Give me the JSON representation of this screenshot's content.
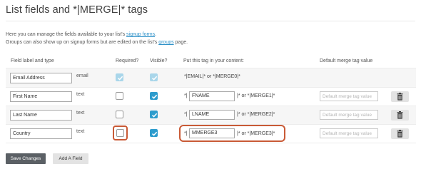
{
  "page": {
    "title": "List fields and *|MERGE|* tags"
  },
  "intro": {
    "line1_prefix": "Here you can manage the fields available to your list's ",
    "line1_link": "signup forms",
    "line1_suffix": ".",
    "line2_prefix": "Groups can also show up on signup forms but are edited on the list's ",
    "line2_link": "groups",
    "line2_suffix": " page."
  },
  "table": {
    "headers": {
      "label": "Field label and type",
      "required": "Required?",
      "visible": "Visible?",
      "tag": "Put this tag in your content:",
      "default": "Default merge tag value"
    },
    "rows": [
      {
        "label": "Email Address",
        "type": "email",
        "required": true,
        "visible": true,
        "locked": true,
        "tag_full": "*|EMAIL|* or *|MERGE0|*"
      },
      {
        "label": "First Name",
        "type": "text",
        "required": false,
        "visible": true,
        "tag_prefix": "*|",
        "tag": "FNAME",
        "tag_suffix": "|* or *|MERGE1|*",
        "default_placeholder": "Default merge tag value"
      },
      {
        "label": "Last Name",
        "type": "text",
        "required": false,
        "visible": true,
        "tag_prefix": "*|",
        "tag": "LNAME",
        "tag_suffix": "|* or *|MERGE2|*",
        "default_placeholder": "Default merge tag value"
      },
      {
        "label": "Country",
        "type": "text",
        "required": false,
        "visible": true,
        "tag_prefix": "*|",
        "tag": "MMERGE3",
        "tag_suffix": "|* or *|MERGE3|*",
        "default_placeholder": "Default merge tag value"
      }
    ]
  },
  "buttons": {
    "save": "Save Changes",
    "add": "Add A Field"
  },
  "icons": {
    "check": "check-icon",
    "trash": "trash-icon"
  },
  "colors": {
    "accent": "#2d9ccd",
    "link": "#2a8fc7",
    "highlight": "#c95a36"
  }
}
